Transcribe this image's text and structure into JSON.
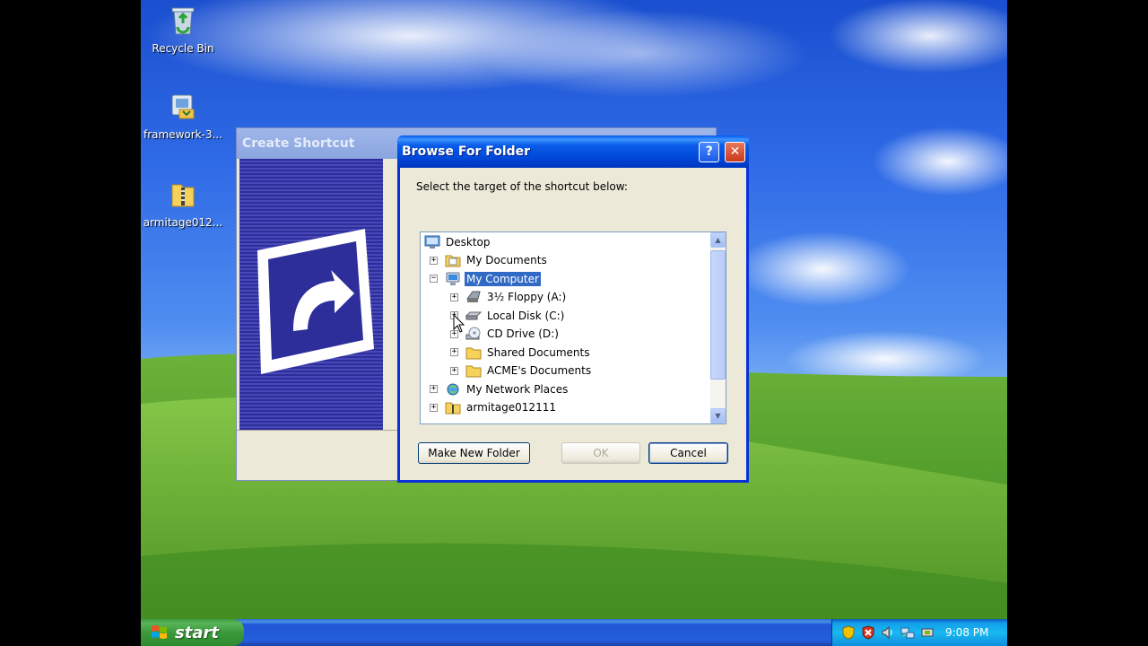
{
  "desktop": {
    "icons": [
      {
        "label": "Recycle Bin",
        "icon": "recycle-bin-icon"
      },
      {
        "label": "framework-3...",
        "icon": "installer-icon"
      },
      {
        "label": "armitage012...",
        "icon": "zip-folder-icon"
      }
    ]
  },
  "create_shortcut": {
    "title": "Create Shortcut"
  },
  "browse_dialog": {
    "title": "Browse For Folder",
    "help_glyph": "?",
    "close_glyph": "✕",
    "instruction": "Select the target of the shortcut below:",
    "tree": [
      {
        "label": "Desktop",
        "icon": "desktop-icon",
        "expander": ""
      },
      {
        "label": "My Documents",
        "icon": "my-documents-icon",
        "expander": "+"
      },
      {
        "label": "My Computer",
        "icon": "my-computer-icon",
        "expander": "−",
        "selected": true
      },
      {
        "label": "3½ Floppy (A:)",
        "icon": "floppy-drive-icon",
        "expander": "+"
      },
      {
        "label": "Local Disk (C:)",
        "icon": "hard-disk-icon",
        "expander": "+"
      },
      {
        "label": "CD Drive (D:)",
        "icon": "cd-drive-icon",
        "expander": "+"
      },
      {
        "label": "Shared Documents",
        "icon": "folder-icon",
        "expander": "+"
      },
      {
        "label": "ACME's Documents",
        "icon": "folder-icon",
        "expander": "+"
      },
      {
        "label": "My Network Places",
        "icon": "network-places-icon",
        "expander": "+"
      },
      {
        "label": "armitage012111",
        "icon": "zip-folder-icon",
        "expander": "+"
      }
    ],
    "buttons": {
      "make_new_folder": "Make New Folder",
      "ok": "OK",
      "cancel": "Cancel"
    },
    "scroll_up": "▲",
    "scroll_down": "▼"
  },
  "taskbar": {
    "start_label": "start",
    "clock": "9:08 PM",
    "tray_icons": [
      "security-shield-icon",
      "security-alert-icon",
      "volume-icon",
      "network-icon",
      "safely-remove-icon"
    ]
  },
  "colors": {
    "title_blue": "#0058ee",
    "selection": "#316ac5",
    "start_green": "#3a9a3a"
  }
}
